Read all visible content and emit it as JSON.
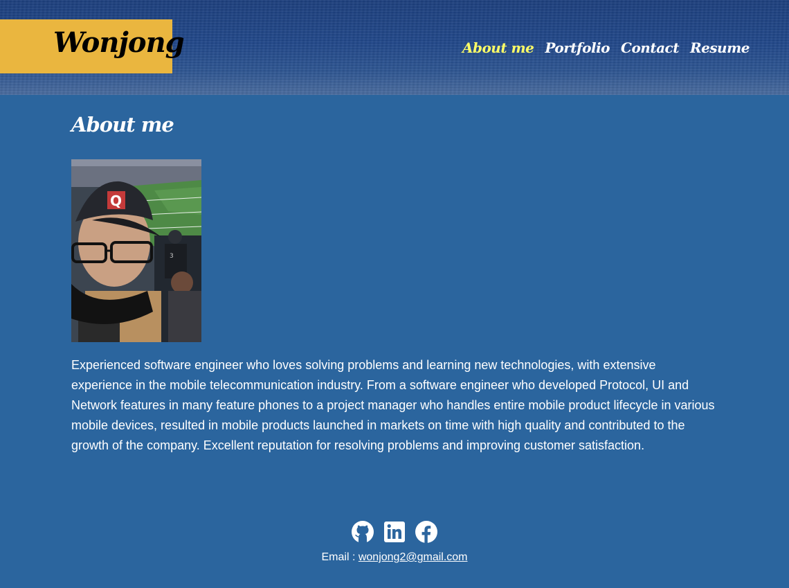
{
  "header": {
    "logo": "Wonjong",
    "nav": [
      {
        "label": "About me",
        "active": true
      },
      {
        "label": "Portfolio",
        "active": false
      },
      {
        "label": "Contact",
        "active": false
      },
      {
        "label": "Resume",
        "active": false
      }
    ]
  },
  "main": {
    "title": "About me",
    "photo_icon": "profile-photo",
    "bio": "Experienced software engineer who loves solving problems and learning new technologies, with extensive experience in the mobile telecommunication industry. From a software engineer who developed Protocol, UI and Network features in many feature phones to a project manager who handles entire mobile product lifecycle in various mobile devices, resulted in mobile products launched in markets on time with high quality and contributed to the growth of the company. Excellent reputation for resolving problems and improving customer satisfaction."
  },
  "footer": {
    "socials": [
      "github-icon",
      "linkedin-icon",
      "facebook-icon"
    ],
    "email_label": "Email : ",
    "email": "wonjong2@gmail.com"
  },
  "colors": {
    "background": "#2b659e",
    "logo_box": "#eab63f",
    "nav_active": "#ffff66",
    "text": "#ffffff"
  }
}
